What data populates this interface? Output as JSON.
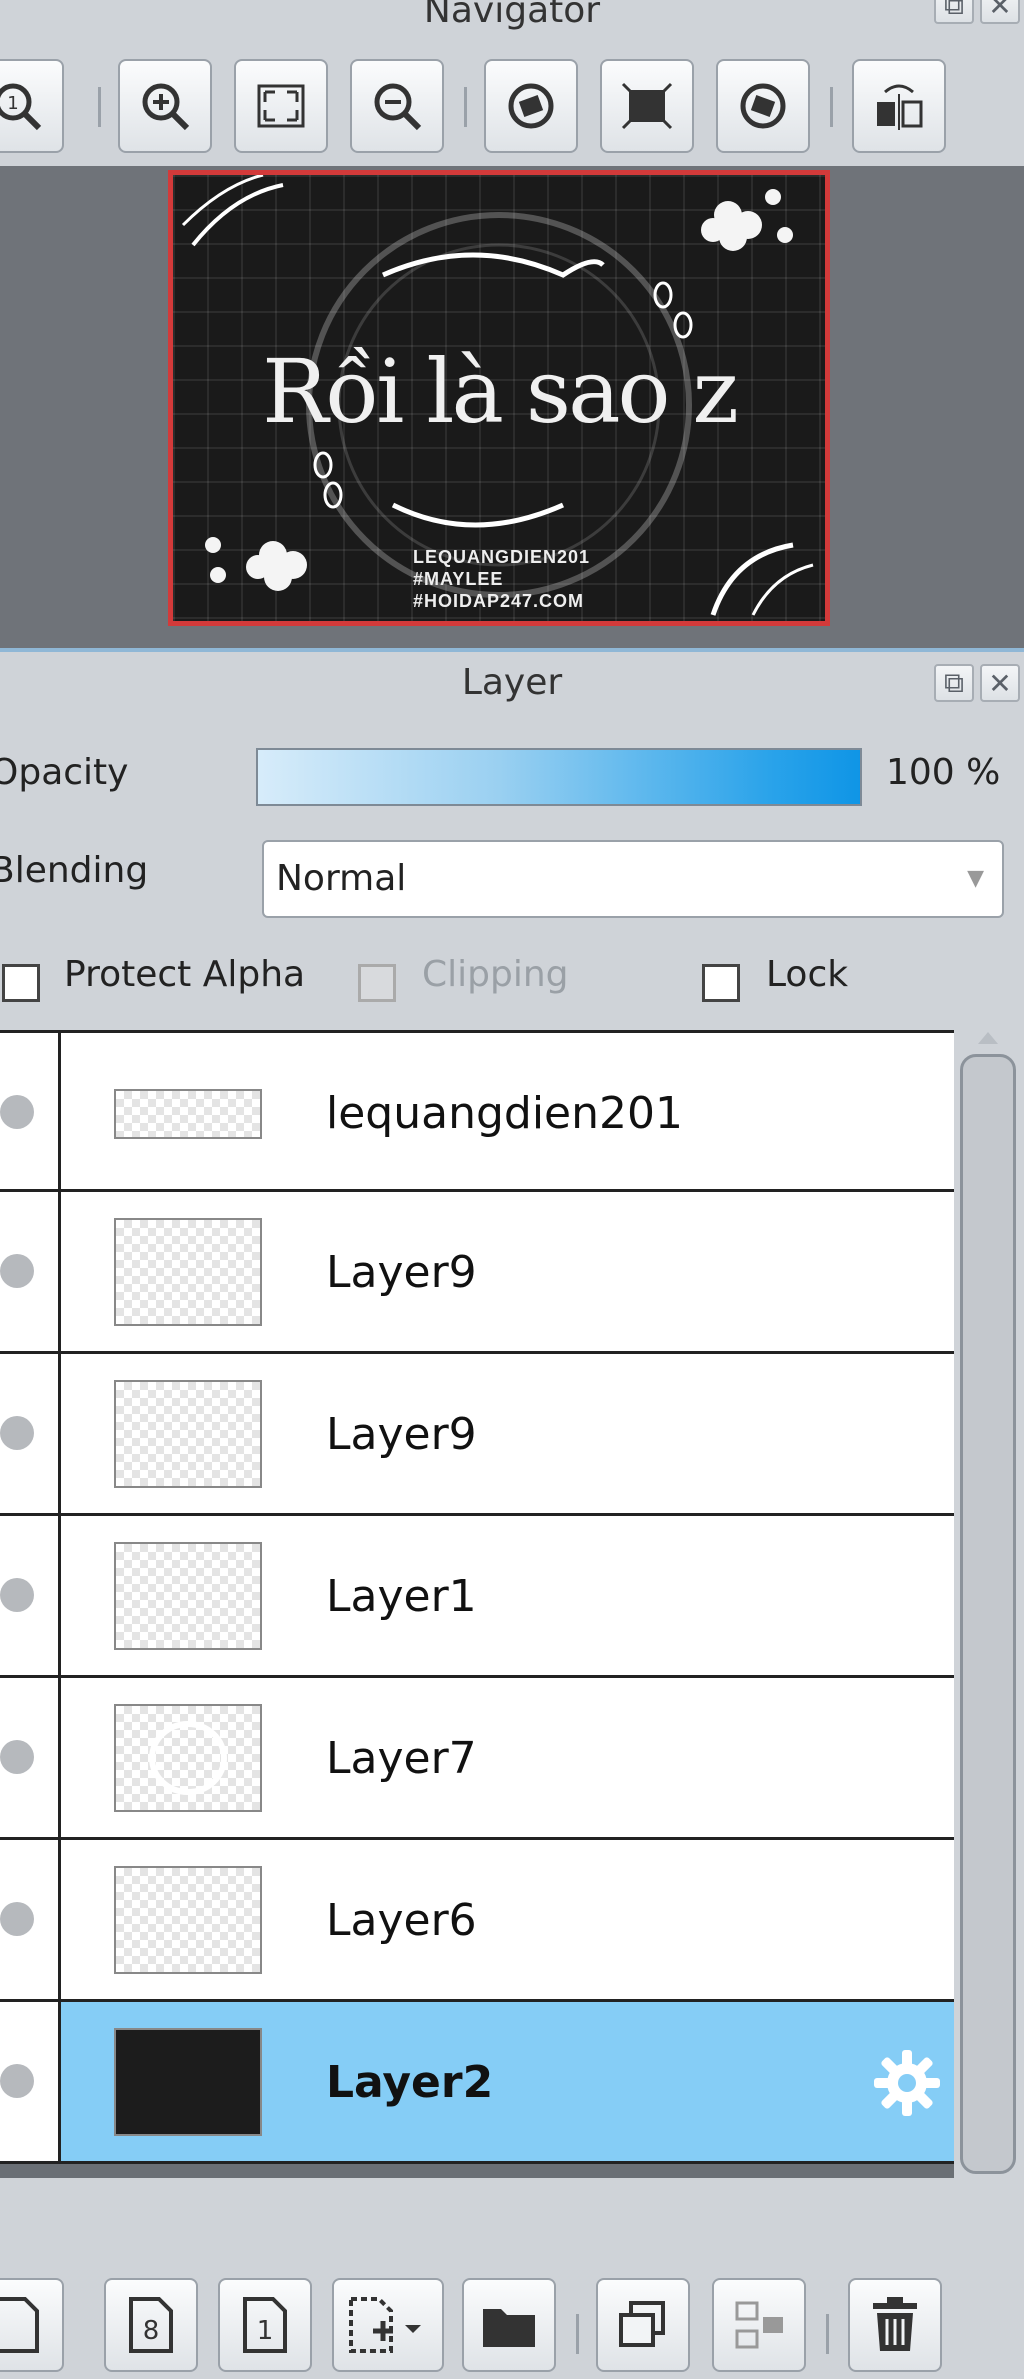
{
  "navigator": {
    "title": "Navigator",
    "artwork": {
      "title_text": "Rồi là sao z",
      "line1": "LEQUANGDIEN201",
      "line2": "#MAYLEE",
      "line3": "#HOIDAP247.COM"
    }
  },
  "layer_panel": {
    "title": "Layer",
    "opacity_label": "Opacity",
    "opacity_value": "100 %",
    "opacity_level": 1.0,
    "blending_label": "Blending",
    "blending_value": "Normal",
    "protect_alpha_label": "Protect Alpha",
    "clipping_label": "Clipping",
    "lock_label": "Lock",
    "layers": [
      {
        "name": "lequangdien201"
      },
      {
        "name": "Layer9"
      },
      {
        "name": "Layer9"
      },
      {
        "name": "Layer1"
      },
      {
        "name": "Layer7"
      },
      {
        "name": "Layer6"
      },
      {
        "name": "Layer2"
      }
    ]
  },
  "colors": {
    "selected_row": "#85cdf6",
    "opacity_fill": "#0f95e6",
    "nav_frame": "#d33a3a"
  }
}
